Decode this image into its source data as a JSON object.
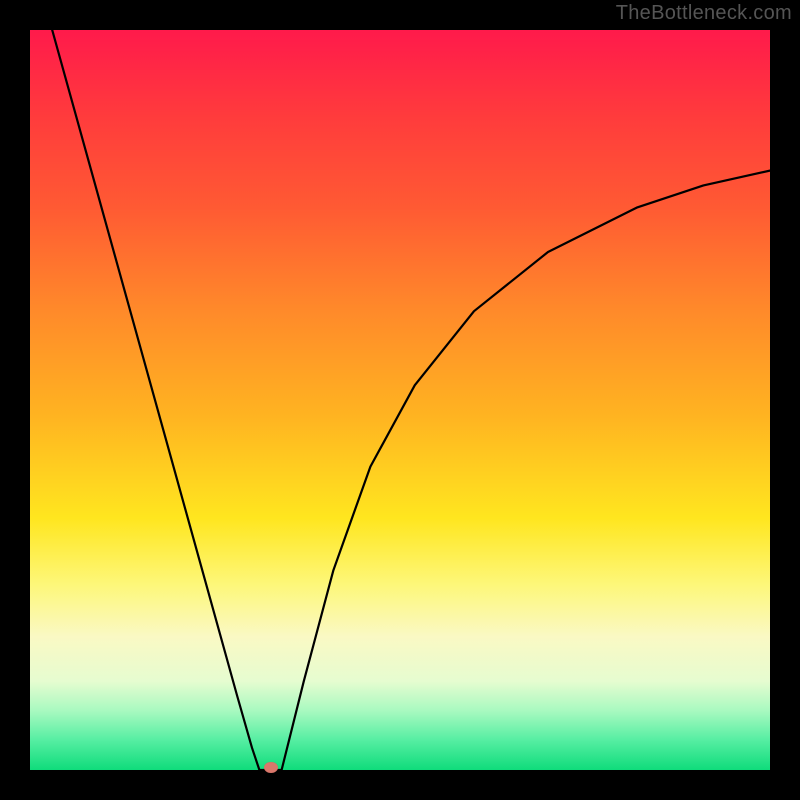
{
  "attribution": "TheBottleneck.com",
  "colors": {
    "gradient_top": "#ff1a4b",
    "gradient_bottom": "#0fdc7b",
    "curve": "#000000",
    "marker": "#d9776b",
    "frame": "#000000"
  },
  "marker": {
    "x_frac": 0.325,
    "note": "red oval at curve minimum"
  },
  "chart_data": {
    "type": "line",
    "title": "",
    "xlabel": "",
    "ylabel": "",
    "xlim": [
      0,
      1
    ],
    "ylim": [
      0,
      1
    ],
    "series": [
      {
        "name": "left-branch",
        "x": [
          0.03,
          0.08,
          0.13,
          0.18,
          0.23,
          0.28,
          0.3,
          0.31
        ],
        "y": [
          1.0,
          0.82,
          0.64,
          0.46,
          0.28,
          0.1,
          0.03,
          0.0
        ]
      },
      {
        "name": "flat-min",
        "x": [
          0.31,
          0.325,
          0.34
        ],
        "y": [
          0.0,
          0.0,
          0.0
        ]
      },
      {
        "name": "right-branch",
        "x": [
          0.34,
          0.37,
          0.41,
          0.46,
          0.52,
          0.6,
          0.7,
          0.82,
          0.91,
          1.0
        ],
        "y": [
          0.0,
          0.12,
          0.27,
          0.41,
          0.52,
          0.62,
          0.7,
          0.76,
          0.79,
          0.81
        ]
      }
    ],
    "annotations": [
      {
        "type": "point",
        "x": 0.325,
        "y": 0.0,
        "label": "minimum marker"
      }
    ]
  }
}
